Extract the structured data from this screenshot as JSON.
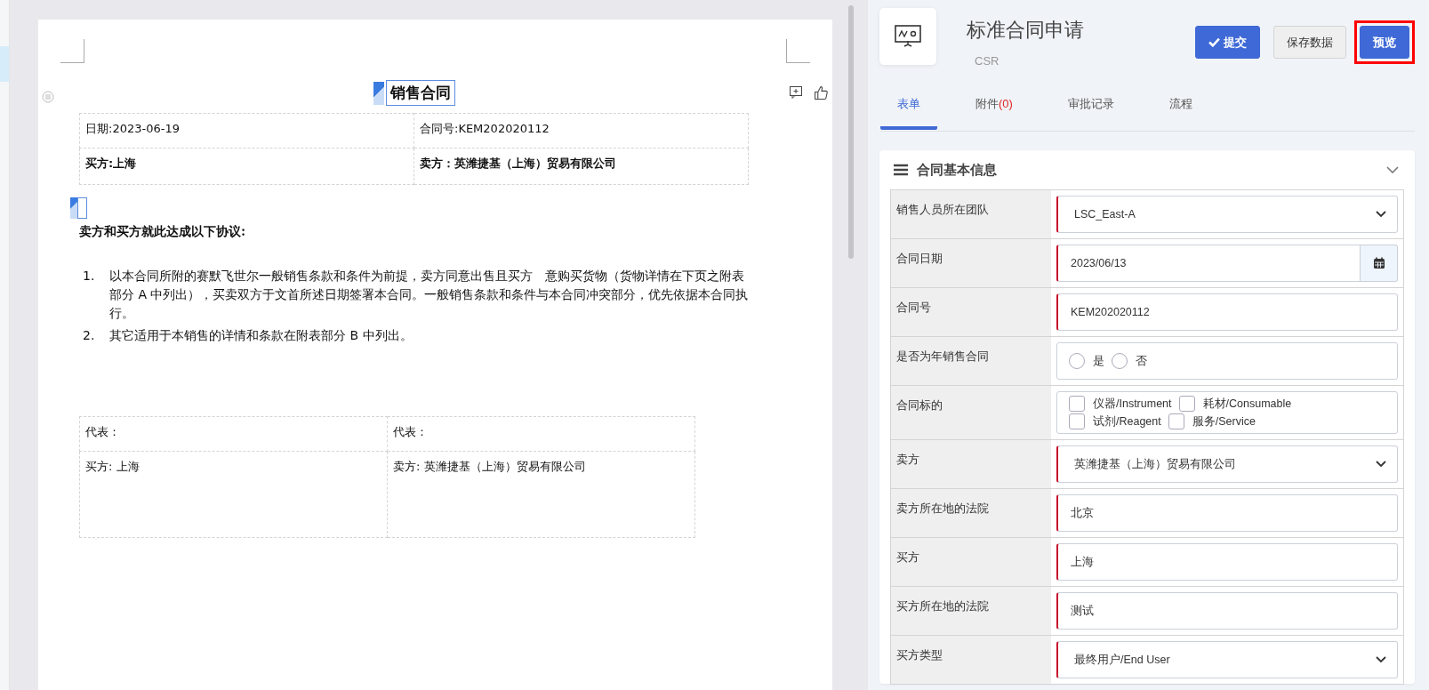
{
  "document": {
    "title": "销售合同",
    "header_table": [
      [
        "日期:2023-06-19",
        "合同号:KEM202020112"
      ],
      [
        "买方:上海",
        "卖方：英潍捷基（上海）贸易有限公司"
      ]
    ],
    "header_bold_rows": [
      false,
      true
    ],
    "agreement_heading": "卖方和买方就此达成以下协议:",
    "clauses": [
      {
        "number": "1.",
        "text": "以本合同所附的赛默飞世尔一般销售条款和条件为前提，卖方同意出售且买方　意购买货物（货物详情在下页之附表部分 A 中列出），买卖双方于文首所述日期签署本合同。一般销售条款和条件与本合同冲突部分，优先依据本合同执行。"
      },
      {
        "number": "2.",
        "text": "其它适用于本销售的详情和条款在附表部分 B 中列出。"
      }
    ],
    "signature_table": [
      [
        "代表：",
        "代表："
      ],
      [
        "买方: 上海",
        "卖方: 英潍捷基（上海）贸易有限公司"
      ]
    ]
  },
  "header": {
    "title": "标准合同申请",
    "subtitle": "CSR",
    "buttons": [
      {
        "label": "提交",
        "kind": "primary",
        "icon": true,
        "highlighted": false
      },
      {
        "label": "保存数据",
        "kind": "default",
        "icon": false,
        "highlighted": false
      },
      {
        "label": "预览",
        "kind": "primary",
        "icon": false,
        "highlighted": true
      }
    ]
  },
  "tabs": [
    {
      "label": "表单",
      "selected": true
    },
    {
      "label": "附件",
      "count": "(0)",
      "selected": false
    },
    {
      "label": "审批记录",
      "selected": false
    },
    {
      "label": "流程",
      "selected": false
    }
  ],
  "section": {
    "title": "合同基本信息",
    "expanded": true,
    "fields": [
      {
        "label": "销售人员所在团队",
        "kind": "select",
        "value": "LSC_East-A",
        "required": true
      },
      {
        "label": "合同日期",
        "kind": "date",
        "value": "2023/06/13",
        "required": true
      },
      {
        "label": "合同号",
        "kind": "text",
        "value": "KEM202020112",
        "required": true
      },
      {
        "label": "是否为年销售合同",
        "kind": "radio",
        "required": false,
        "options": [
          {
            "label": "是",
            "selected": false
          },
          {
            "label": "否",
            "selected": false
          }
        ]
      },
      {
        "label": "合同标的",
        "kind": "checkbox",
        "required": false,
        "options": [
          {
            "label": "仪器/Instrument",
            "checked": false
          },
          {
            "label": "耗材/Consumable",
            "checked": false
          },
          {
            "label": "试剂/Reagent",
            "checked": false
          },
          {
            "label": "服务/Service",
            "checked": false
          }
        ]
      },
      {
        "label": "卖方",
        "kind": "select",
        "value": "英潍捷基（上海）贸易有限公司",
        "required": true
      },
      {
        "label": "卖方所在地的法院",
        "kind": "text",
        "value": "北京",
        "required": true
      },
      {
        "label": "买方",
        "kind": "text",
        "value": "上海",
        "required": true
      },
      {
        "label": "买方所在地的法院",
        "kind": "text",
        "value": "测试",
        "required": true
      },
      {
        "label": "买方类型",
        "kind": "select",
        "value": "最终用户/End User",
        "required": true
      }
    ]
  }
}
